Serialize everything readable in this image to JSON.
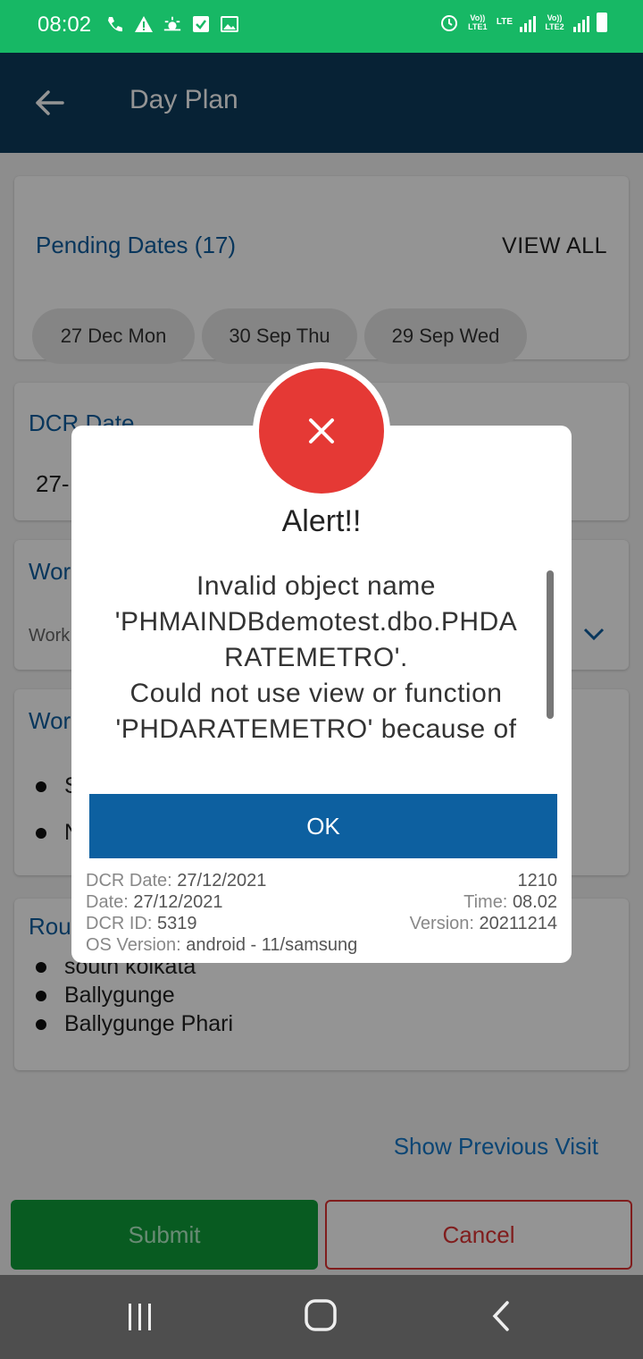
{
  "status_bar": {
    "time": "08:02",
    "left_icons": [
      "wifi-call-icon",
      "warning-icon",
      "weather-icon",
      "checkbox-icon",
      "image-icon"
    ],
    "right_icons": [
      "alarm-icon",
      "volte-lte1-icon",
      "signal-icon",
      "volte-lte2-icon",
      "signal-icon",
      "battery-icon"
    ],
    "sim1": "Vo)) LTE1",
    "sim2": "Vo)) LTE2",
    "lte": "LTE",
    "color": "#17b865"
  },
  "app_bar": {
    "title": "Day Plan",
    "color": "#0d3c5c"
  },
  "pending": {
    "title": "Pending Dates (17)",
    "view_all": "VIEW ALL",
    "chips": [
      "27 Dec Mon",
      "30 Sep Thu",
      "29 Sep Wed"
    ]
  },
  "dcr_card": {
    "title": "DCR Date",
    "value": "27-"
  },
  "work_type_card": {
    "title": "Wor",
    "value": "Work"
  },
  "work_with_card": {
    "title": "Wor",
    "items": [
      "S",
      "N"
    ]
  },
  "route_card": {
    "title": "Rou",
    "items": [
      "south kolkata",
      "Ballygunge",
      "Ballygunge Phari"
    ]
  },
  "show_previous": "Show Previous Visit",
  "submit": "Submit",
  "cancel": "Cancel",
  "dialog": {
    "title": "Alert!!",
    "message_lines": [
      "Invalid object name",
      "'PHMAINDBdemotest.dbo.PHDA",
      "RATEMETRO'.",
      "Could not use view or function",
      "'PHDARATEMETRO' because of"
    ],
    "ok": "OK",
    "meta": {
      "dcr_date_label": "DCR Date:",
      "dcr_date": "27/12/2021",
      "date_label": "Date:",
      "date": "27/12/2021",
      "dcr_id_label": "DCR ID:",
      "dcr_id": "5319",
      "os_label": "OS Version:",
      "os": "android - 11/samsung",
      "code": "1210",
      "time_label": "Time:",
      "time": "08.02",
      "version_label": "Version:",
      "version": "20211214"
    },
    "icon_color": "#e53935"
  },
  "nav": {
    "icons": [
      "recent-apps-icon",
      "home-icon",
      "back-icon"
    ]
  }
}
